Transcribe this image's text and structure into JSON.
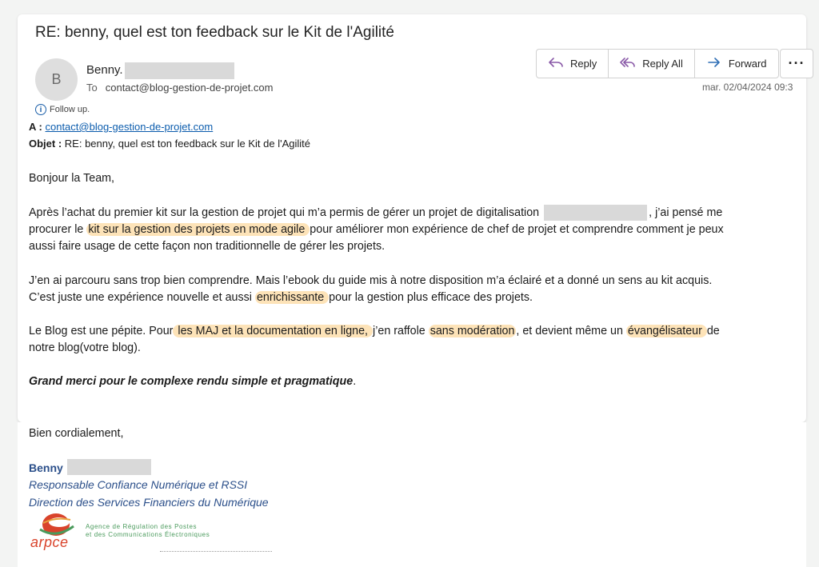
{
  "email": {
    "subject": "RE: benny, quel est ton feedback sur le Kit de l'Agilité",
    "avatar_letter": "B",
    "sender_name": "Benny.",
    "to_label": "To",
    "to_address": "contact@blog-gestion-de-projet.com",
    "date": "mar. 02/04/2024 09:3",
    "follow_up": "Follow up.",
    "actions": {
      "reply": "Reply",
      "reply_all": "Reply All",
      "forward": "Forward",
      "more": "···"
    }
  },
  "headers": {
    "a_label": "A :",
    "a_value": "contact@blog-gestion-de-projet.com",
    "objet_label": "Objet :",
    "objet_value": "RE: benny, quel est ton feedback sur le Kit de l'Agilité"
  },
  "body": {
    "greeting": "Bonjour la Team,",
    "p1_l1_a": "Après l’achat du premier kit sur la gestion de projet qui m’a permis de gérer un projet de digitalisation",
    "p1_l1_b": ", j’ai pensé me",
    "p1_l2_a": "procurer le ",
    "p1_l2_hl": "kit sur la gestion des projets en mode agile ",
    "p1_l2_b": "pour améliorer mon expérience de chef de projet et comprendre comment je peux",
    "p1_l3": "aussi faire usage de cette façon non traditionnelle de gérer les projets.",
    "p2_l1": "J’en ai parcouru sans trop bien comprendre. Mais l’ebook du guide mis à notre disposition m’a éclairé et a donné un sens au kit acquis.",
    "p2_l2_a": "C’est juste une expérience nouvelle et aussi ",
    "p2_l2_hl": "enrichissante ",
    "p2_l2_b": "pour la gestion plus efficace des projets.",
    "p3_l1_a": "Le Blog est une pépite. Pour",
    "p3_l1_hl1": " les MAJ et la documentation en ligne, ",
    "p3_l1_b": " j’en raffole ",
    "p3_l1_hl2": "sans modération",
    "p3_l1_c": ", et devient même un ",
    "p3_l1_hl3": "évangélisateur ",
    "p3_l1_d": "de",
    "p3_l2": "notre blog(votre blog).",
    "thanks_bold": "Grand merci pour le complexe rendu simple et pragmatique",
    "thanks_end": ".",
    "closing": "Bien cordialement,"
  },
  "signature": {
    "name": "Benny",
    "title": "Responsable Confiance Numérique et RSSI",
    "department": "Direction des Services Financiers du Numérique",
    "logo_text": "arpce",
    "agency_l1": "Agence de Régulation des Postes",
    "agency_l2": "et des Communications Électroniques"
  },
  "colors": {
    "highlight": "#fde3b8",
    "link": "#0b5cad",
    "signature": "#2b4f8a",
    "logo_red": "#d9432b",
    "logo_green": "#4a9a5c"
  }
}
